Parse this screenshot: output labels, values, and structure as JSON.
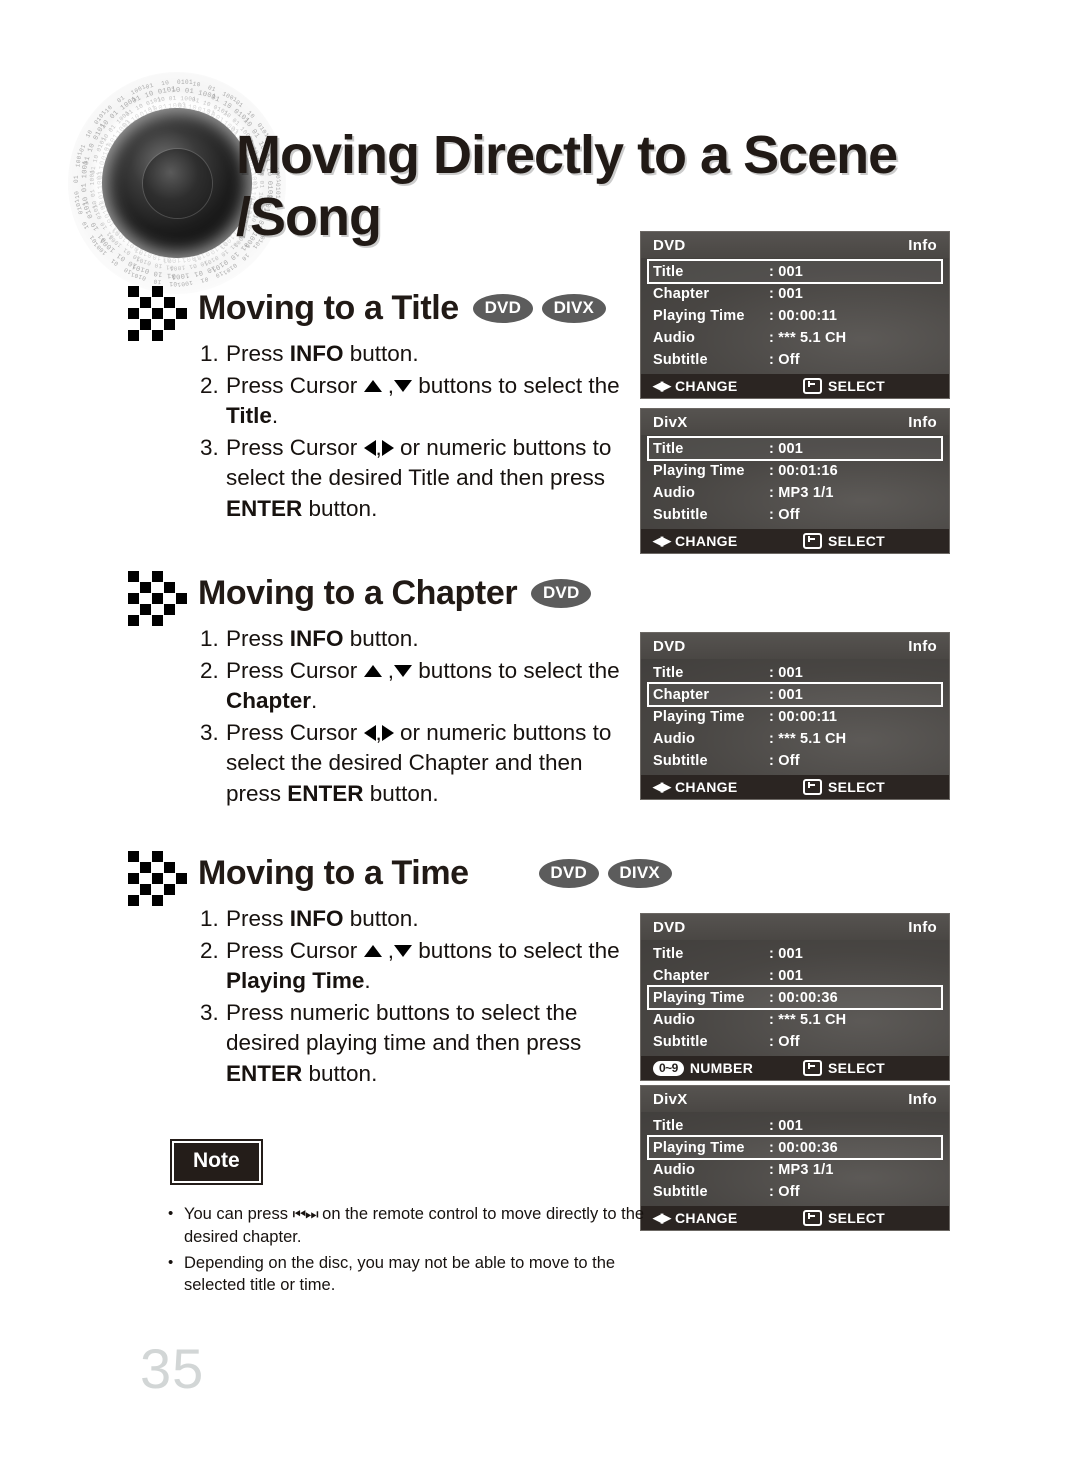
{
  "header": {
    "title": "Moving Directly to a Scene /Song",
    "graphic": "speaker-cone-binary-ring"
  },
  "sections": [
    {
      "id": "title",
      "heading": "Moving to a Title",
      "badges": [
        "DVD",
        "DIVX"
      ],
      "steps": [
        {
          "num": "1.",
          "parts": [
            {
              "t": "Press "
            },
            {
              "t": "INFO",
              "b": true
            },
            {
              "t": " button."
            }
          ]
        },
        {
          "num": "2.",
          "parts": [
            {
              "t": "Press Cursor "
            },
            {
              "icon": "arrow-up"
            },
            {
              "t": " ,"
            },
            {
              "icon": "arrow-down"
            },
            {
              "t": " buttons to select the "
            },
            {
              "t": "Title",
              "b": true
            },
            {
              "t": "."
            }
          ]
        },
        {
          "num": "3.",
          "parts": [
            {
              "t": "Press Cursor "
            },
            {
              "icon": "arrow-left"
            },
            {
              "t": ","
            },
            {
              "icon": "arrow-right"
            },
            {
              "t": " or numeric buttons to select the desired Title and then press "
            },
            {
              "t": "ENTER",
              "b": true
            },
            {
              "t": " button."
            }
          ]
        }
      ]
    },
    {
      "id": "chapter",
      "heading": "Moving to a Chapter",
      "badges": [
        "DVD"
      ],
      "steps": [
        {
          "num": "1.",
          "parts": [
            {
              "t": "Press "
            },
            {
              "t": "INFO",
              "b": true
            },
            {
              "t": " button."
            }
          ]
        },
        {
          "num": "2.",
          "parts": [
            {
              "t": "Press Cursor "
            },
            {
              "icon": "arrow-up"
            },
            {
              "t": " ,"
            },
            {
              "icon": "arrow-down"
            },
            {
              "t": " buttons to select the "
            },
            {
              "t": "Chapter",
              "b": true
            },
            {
              "t": "."
            }
          ]
        },
        {
          "num": "3.",
          "parts": [
            {
              "t": "Press Cursor "
            },
            {
              "icon": "arrow-left"
            },
            {
              "t": ","
            },
            {
              "icon": "arrow-right"
            },
            {
              "t": " or numeric buttons to select the desired Chapter and then press "
            },
            {
              "t": "ENTER",
              "b": true
            },
            {
              "t": " button."
            }
          ]
        }
      ]
    },
    {
      "id": "time",
      "heading": "Moving to a Time",
      "badges": [
        "DVD",
        "DIVX"
      ],
      "steps": [
        {
          "num": "1.",
          "parts": [
            {
              "t": "Press "
            },
            {
              "t": "INFO",
              "b": true
            },
            {
              "t": " button."
            }
          ]
        },
        {
          "num": "2.",
          "parts": [
            {
              "t": "Press Cursor "
            },
            {
              "icon": "arrow-up"
            },
            {
              "t": " ,"
            },
            {
              "icon": "arrow-down"
            },
            {
              "t": " buttons to select the "
            },
            {
              "t": "Playing Time",
              "b": true
            },
            {
              "t": "."
            }
          ]
        },
        {
          "num": "3.",
          "parts": [
            {
              "t": "Press numeric buttons to select the desired playing time and then press "
            },
            {
              "t": "ENTER",
              "b": true
            },
            {
              "t": " button."
            }
          ]
        }
      ]
    }
  ],
  "osd_panels": [
    {
      "id": "dvd-title",
      "disc": "DVD",
      "info_label": "Info",
      "rows": [
        {
          "key": "Title",
          "value": ": 001",
          "selected": true
        },
        {
          "key": "Chapter",
          "value": ": 001",
          "selected": false
        },
        {
          "key": "Playing Time",
          "value": ": 00:00:11",
          "selected": false
        },
        {
          "key": "Audio",
          "value": ": *** 5.1 CH",
          "selected": false
        },
        {
          "key": "Subtitle",
          "value": ": Off",
          "selected": false
        }
      ],
      "footer": {
        "left_icon": "left-right-arrows",
        "left": "CHANGE",
        "right_icon": "enter-key",
        "right": "SELECT"
      }
    },
    {
      "id": "divx-title",
      "disc": "DivX",
      "info_label": "Info",
      "rows": [
        {
          "key": "Title",
          "value": ": 001",
          "selected": true
        },
        {
          "key": "Playing Time",
          "value": ": 00:01:16",
          "selected": false
        },
        {
          "key": "Audio",
          "value": ": MP3 1/1",
          "selected": false
        },
        {
          "key": "Subtitle",
          "value": ": Off",
          "selected": false
        }
      ],
      "footer": {
        "left_icon": "left-right-arrows",
        "left": "CHANGE",
        "right_icon": "enter-key",
        "right": "SELECT"
      }
    },
    {
      "id": "dvd-chapter",
      "disc": "DVD",
      "info_label": "Info",
      "rows": [
        {
          "key": "Title",
          "value": ": 001",
          "selected": false
        },
        {
          "key": "Chapter",
          "value": ": 001",
          "selected": true
        },
        {
          "key": "Playing Time",
          "value": ": 00:00:11",
          "selected": false
        },
        {
          "key": "Audio",
          "value": ": *** 5.1 CH",
          "selected": false
        },
        {
          "key": "Subtitle",
          "value": ": Off",
          "selected": false
        }
      ],
      "footer": {
        "left_icon": "left-right-arrows",
        "left": "CHANGE",
        "right_icon": "enter-key",
        "right": "SELECT"
      }
    },
    {
      "id": "dvd-time",
      "disc": "DVD",
      "info_label": "Info",
      "rows": [
        {
          "key": "Title",
          "value": ": 001",
          "selected": false
        },
        {
          "key": "Chapter",
          "value": ": 001",
          "selected": false
        },
        {
          "key": "Playing Time",
          "value": ": 00:00:36",
          "selected": true
        },
        {
          "key": "Audio",
          "value": ": *** 5.1 CH",
          "selected": false
        },
        {
          "key": "Subtitle",
          "value": ": Off",
          "selected": false
        }
      ],
      "footer": {
        "left_icon": "number-pill",
        "left_pill": "0~9",
        "left": "NUMBER",
        "right_icon": "enter-key",
        "right": "SELECT"
      }
    },
    {
      "id": "divx-time",
      "disc": "DivX",
      "info_label": "Info",
      "rows": [
        {
          "key": "Title",
          "value": ": 001",
          "selected": false
        },
        {
          "key": "Playing Time",
          "value": ": 00:00:36",
          "selected": true
        },
        {
          "key": "Audio",
          "value": ": MP3 1/1",
          "selected": false
        },
        {
          "key": "Subtitle",
          "value": ": Off",
          "selected": false
        }
      ],
      "footer": {
        "left_icon": "left-right-arrows",
        "left": "CHANGE",
        "right_icon": "enter-key",
        "right": "SELECT"
      }
    }
  ],
  "note": {
    "label": "Note",
    "items": [
      {
        "parts": [
          {
            "t": "You can press "
          },
          {
            "icon": "skip-prev-next"
          },
          {
            "t": " on the remote control to move directly to the desired chapter."
          }
        ]
      },
      {
        "parts": [
          {
            "t": "Depending on the disc, you may not be able to move to the selected title or time."
          }
        ]
      }
    ]
  },
  "page_number": "35",
  "colors": {
    "text": "#17120f",
    "badge_bg": "#5c5c5c",
    "osd_bg": "#504d4a",
    "osd_footer_bg": "#2b2522",
    "page_number": "#d2d6d6"
  }
}
